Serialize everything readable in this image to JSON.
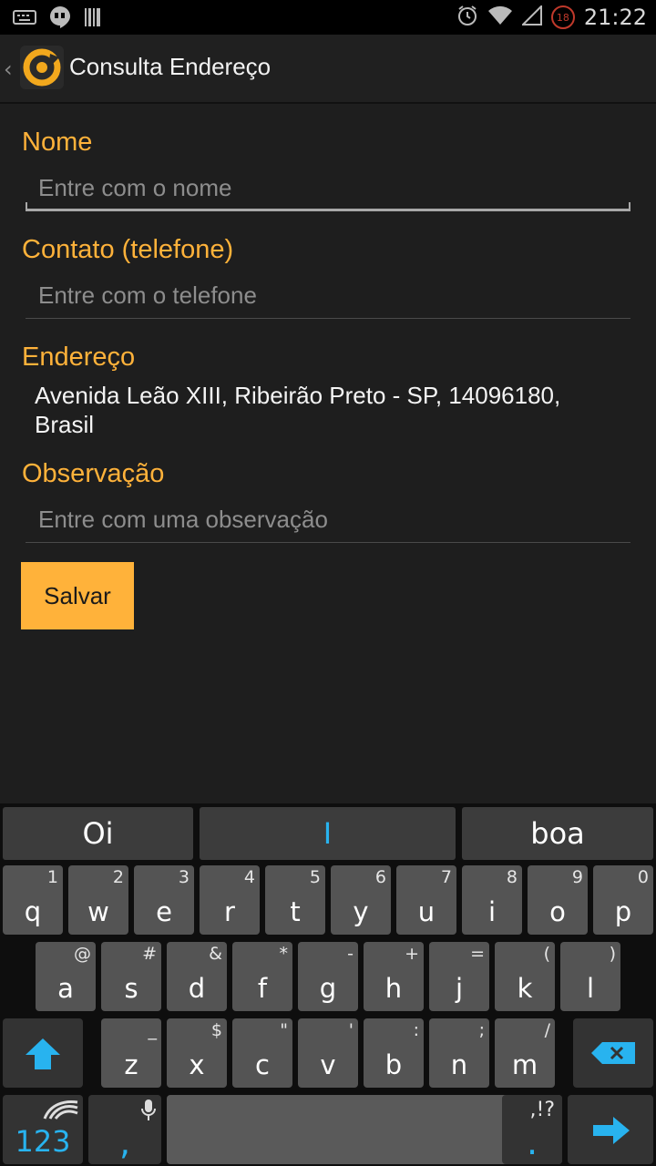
{
  "status_bar": {
    "time": "21:22",
    "notification_count": "18",
    "left_icons": [
      "keyboard-icon",
      "hangouts-icon",
      "barcode-icon"
    ],
    "right_icons": [
      "alarm-icon",
      "wifi-icon",
      "signal-icon",
      "notification-badge"
    ]
  },
  "action_bar": {
    "title": "Consulta Endereço",
    "back_icon": "chevron-left-icon",
    "logo_icon": "app-logo-icon"
  },
  "form": {
    "nome": {
      "label": "Nome",
      "placeholder": "Entre com o nome",
      "value": ""
    },
    "contato": {
      "label": "Contato (telefone)",
      "placeholder": "Entre com o telefone",
      "value": ""
    },
    "endereco": {
      "label": "Endereço",
      "line1": "Avenida Leão XIII, Ribeirão Preto - SP, 14096180,",
      "line2": "Brasil"
    },
    "observacao": {
      "label": "Observação",
      "placeholder": "Entre com uma observação",
      "value": ""
    },
    "save_label": "Salvar"
  },
  "keyboard": {
    "suggestions": [
      "Oi",
      "I",
      "boa"
    ],
    "row1": [
      {
        "main": "q",
        "sub": "1"
      },
      {
        "main": "w",
        "sub": "2"
      },
      {
        "main": "e",
        "sub": "3"
      },
      {
        "main": "r",
        "sub": "4"
      },
      {
        "main": "t",
        "sub": "5"
      },
      {
        "main": "y",
        "sub": "6"
      },
      {
        "main": "u",
        "sub": "7"
      },
      {
        "main": "i",
        "sub": "8"
      },
      {
        "main": "o",
        "sub": "9"
      },
      {
        "main": "p",
        "sub": "0"
      }
    ],
    "row2": [
      {
        "main": "a",
        "sub": "@"
      },
      {
        "main": "s",
        "sub": "#"
      },
      {
        "main": "d",
        "sub": "&"
      },
      {
        "main": "f",
        "sub": "*"
      },
      {
        "main": "g",
        "sub": "-"
      },
      {
        "main": "h",
        "sub": "+"
      },
      {
        "main": "j",
        "sub": "="
      },
      {
        "main": "k",
        "sub": "("
      },
      {
        "main": "l",
        "sub": ")"
      }
    ],
    "row3": [
      {
        "main": "z",
        "sub": "_"
      },
      {
        "main": "x",
        "sub": "$"
      },
      {
        "main": "c",
        "sub": "\""
      },
      {
        "main": "v",
        "sub": "'"
      },
      {
        "main": "b",
        "sub": ":"
      },
      {
        "main": "n",
        "sub": ";"
      },
      {
        "main": "m",
        "sub": "/"
      }
    ],
    "numbers_label": "123",
    "comma_label": ",",
    "period_label": ".",
    "period_sub": ",!?",
    "shift_icon": "shift-arrow-icon",
    "backspace_icon": "backspace-icon",
    "enter_icon": "enter-arrow-icon",
    "mic_icon": "microphone-icon",
    "swiftkey_icon": "swiftkey-logo-icon",
    "accent_color": "#28b3ef",
    "label_color": "#ffb23a"
  }
}
